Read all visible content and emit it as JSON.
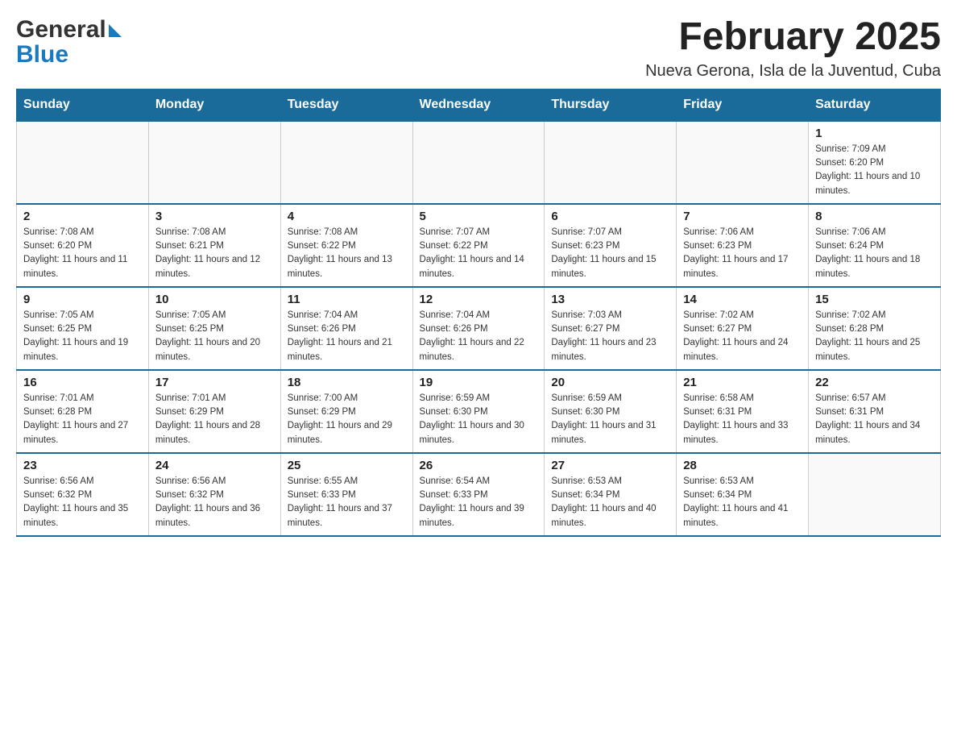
{
  "logo": {
    "general": "General",
    "blue": "Blue",
    "arrow_char": "▶"
  },
  "header": {
    "month_title": "February 2025",
    "location": "Nueva Gerona, Isla de la Juventud, Cuba"
  },
  "calendar": {
    "days_of_week": [
      "Sunday",
      "Monday",
      "Tuesday",
      "Wednesday",
      "Thursday",
      "Friday",
      "Saturday"
    ],
    "weeks": [
      {
        "days": [
          {
            "number": "",
            "info": ""
          },
          {
            "number": "",
            "info": ""
          },
          {
            "number": "",
            "info": ""
          },
          {
            "number": "",
            "info": ""
          },
          {
            "number": "",
            "info": ""
          },
          {
            "number": "",
            "info": ""
          },
          {
            "number": "1",
            "info": "Sunrise: 7:09 AM\nSunset: 6:20 PM\nDaylight: 11 hours and 10 minutes."
          }
        ]
      },
      {
        "days": [
          {
            "number": "2",
            "info": "Sunrise: 7:08 AM\nSunset: 6:20 PM\nDaylight: 11 hours and 11 minutes."
          },
          {
            "number": "3",
            "info": "Sunrise: 7:08 AM\nSunset: 6:21 PM\nDaylight: 11 hours and 12 minutes."
          },
          {
            "number": "4",
            "info": "Sunrise: 7:08 AM\nSunset: 6:22 PM\nDaylight: 11 hours and 13 minutes."
          },
          {
            "number": "5",
            "info": "Sunrise: 7:07 AM\nSunset: 6:22 PM\nDaylight: 11 hours and 14 minutes."
          },
          {
            "number": "6",
            "info": "Sunrise: 7:07 AM\nSunset: 6:23 PM\nDaylight: 11 hours and 15 minutes."
          },
          {
            "number": "7",
            "info": "Sunrise: 7:06 AM\nSunset: 6:23 PM\nDaylight: 11 hours and 17 minutes."
          },
          {
            "number": "8",
            "info": "Sunrise: 7:06 AM\nSunset: 6:24 PM\nDaylight: 11 hours and 18 minutes."
          }
        ]
      },
      {
        "days": [
          {
            "number": "9",
            "info": "Sunrise: 7:05 AM\nSunset: 6:25 PM\nDaylight: 11 hours and 19 minutes."
          },
          {
            "number": "10",
            "info": "Sunrise: 7:05 AM\nSunset: 6:25 PM\nDaylight: 11 hours and 20 minutes."
          },
          {
            "number": "11",
            "info": "Sunrise: 7:04 AM\nSunset: 6:26 PM\nDaylight: 11 hours and 21 minutes."
          },
          {
            "number": "12",
            "info": "Sunrise: 7:04 AM\nSunset: 6:26 PM\nDaylight: 11 hours and 22 minutes."
          },
          {
            "number": "13",
            "info": "Sunrise: 7:03 AM\nSunset: 6:27 PM\nDaylight: 11 hours and 23 minutes."
          },
          {
            "number": "14",
            "info": "Sunrise: 7:02 AM\nSunset: 6:27 PM\nDaylight: 11 hours and 24 minutes."
          },
          {
            "number": "15",
            "info": "Sunrise: 7:02 AM\nSunset: 6:28 PM\nDaylight: 11 hours and 25 minutes."
          }
        ]
      },
      {
        "days": [
          {
            "number": "16",
            "info": "Sunrise: 7:01 AM\nSunset: 6:28 PM\nDaylight: 11 hours and 27 minutes."
          },
          {
            "number": "17",
            "info": "Sunrise: 7:01 AM\nSunset: 6:29 PM\nDaylight: 11 hours and 28 minutes."
          },
          {
            "number": "18",
            "info": "Sunrise: 7:00 AM\nSunset: 6:29 PM\nDaylight: 11 hours and 29 minutes."
          },
          {
            "number": "19",
            "info": "Sunrise: 6:59 AM\nSunset: 6:30 PM\nDaylight: 11 hours and 30 minutes."
          },
          {
            "number": "20",
            "info": "Sunrise: 6:59 AM\nSunset: 6:30 PM\nDaylight: 11 hours and 31 minutes."
          },
          {
            "number": "21",
            "info": "Sunrise: 6:58 AM\nSunset: 6:31 PM\nDaylight: 11 hours and 33 minutes."
          },
          {
            "number": "22",
            "info": "Sunrise: 6:57 AM\nSunset: 6:31 PM\nDaylight: 11 hours and 34 minutes."
          }
        ]
      },
      {
        "days": [
          {
            "number": "23",
            "info": "Sunrise: 6:56 AM\nSunset: 6:32 PM\nDaylight: 11 hours and 35 minutes."
          },
          {
            "number": "24",
            "info": "Sunrise: 6:56 AM\nSunset: 6:32 PM\nDaylight: 11 hours and 36 minutes."
          },
          {
            "number": "25",
            "info": "Sunrise: 6:55 AM\nSunset: 6:33 PM\nDaylight: 11 hours and 37 minutes."
          },
          {
            "number": "26",
            "info": "Sunrise: 6:54 AM\nSunset: 6:33 PM\nDaylight: 11 hours and 39 minutes."
          },
          {
            "number": "27",
            "info": "Sunrise: 6:53 AM\nSunset: 6:34 PM\nDaylight: 11 hours and 40 minutes."
          },
          {
            "number": "28",
            "info": "Sunrise: 6:53 AM\nSunset: 6:34 PM\nDaylight: 11 hours and 41 minutes."
          },
          {
            "number": "",
            "info": ""
          }
        ]
      }
    ]
  }
}
